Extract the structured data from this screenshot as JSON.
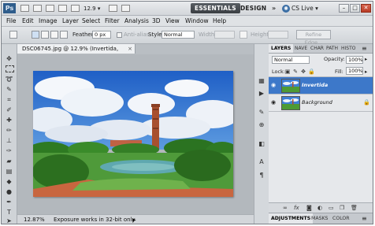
{
  "appbar": {
    "logo": "Ps",
    "zoom_value": "12.9",
    "zoom_arrow": "▾",
    "workspace_active": "ESSENTIALS",
    "workspace_design": "DESIGN",
    "more": "»",
    "cs_live": "CS Live",
    "cs_live_arrow": "▾",
    "minimize": "–",
    "maximize": "□",
    "close": "✕"
  },
  "menu": {
    "file": "File",
    "edit": "Edit",
    "image": "Image",
    "layer": "Layer",
    "select": "Select",
    "filter": "Filter",
    "analysis": "Analysis",
    "threed": "3D",
    "view": "View",
    "window": "Window",
    "help": "Help"
  },
  "options": {
    "feather_label": "Feather:",
    "feather_value": "0 px",
    "antialias_label": "Anti-alias",
    "style_label": "Style:",
    "style_value": "Normal",
    "width_label": "Width:",
    "height_label": "Height:",
    "refine_edge": "Refine Edge..."
  },
  "document": {
    "tab_title": "DSC06745.jpg @ 12.9% (Invertida, RGB/16*) *",
    "tab_close": "×",
    "status_zoom": "12.87%",
    "status_info": "Exposure works in 32-bit only",
    "status_arrow": "▶"
  },
  "layers_panel": {
    "tabs": [
      "LAYERS",
      "NAVE",
      "CHAR",
      "PATH",
      "HISTO"
    ],
    "blend_mode": "Normal",
    "opacity_label": "Opacity:",
    "opacity_value": "100%",
    "lock_label": "Lock:",
    "fill_label": "Fill:",
    "fill_value": "100%",
    "layers": [
      {
        "name": "Invertida",
        "visible": true,
        "selected": true
      },
      {
        "name": "Background",
        "visible": true,
        "locked": true
      }
    ],
    "footer_icons": [
      "link-icon",
      "fx-icon",
      "mask-icon",
      "adjustment-icon",
      "folder-icon",
      "new-layer-icon",
      "trash-icon"
    ],
    "bottom_tabs": [
      "ADJUSTMENTS",
      "MASKS",
      "COLOR"
    ]
  },
  "colors": {
    "selected_layer": "#3d78c9",
    "workspace_active": "#3a3e43",
    "ps_logo": "#2f5d8c"
  }
}
